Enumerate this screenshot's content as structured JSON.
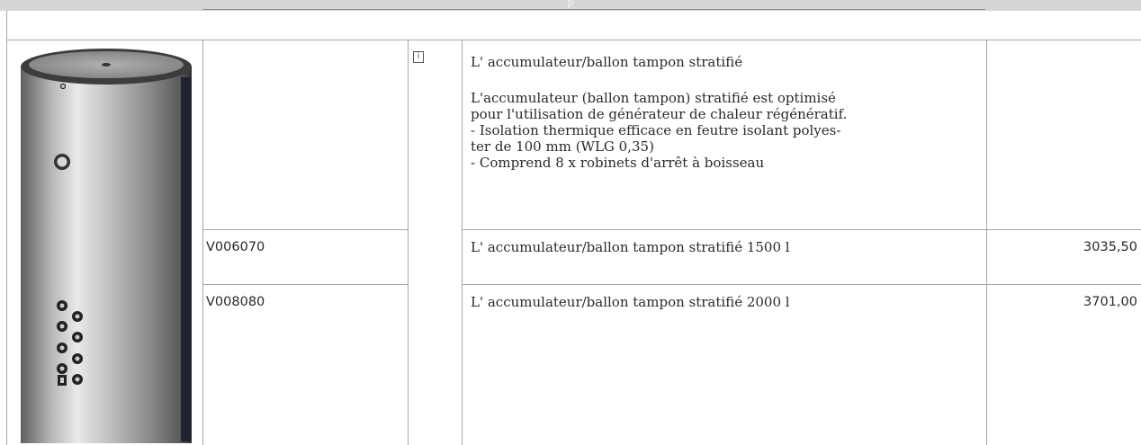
{
  "header": {
    "glyph": "p"
  },
  "info_icon": {
    "glyph": "i"
  },
  "product": {
    "image_icon": "storage-tank-image",
    "title": "L' accumulateur/ballon tampon stratifié",
    "description": [
      "L'accumulateur (ballon tampon) stratifié est optimisé",
      "pour l'utilisation de générateur de chaleur régénératif.",
      "- Isolation thermique efficace en feutre isolant polyes-",
      "ter de 100 mm (WLG 0,35)",
      "- Comprend 8 x robinets d'arrêt à boisseau"
    ]
  },
  "rows": [
    {
      "code": "V006070",
      "label": "L' accumulateur/ballon tampon stratifié 1500 l",
      "price": "3035,50"
    },
    {
      "code": "V008080",
      "label": "L' accumulateur/ballon tampon stratifié 2000 l",
      "price": "3701,00"
    }
  ]
}
